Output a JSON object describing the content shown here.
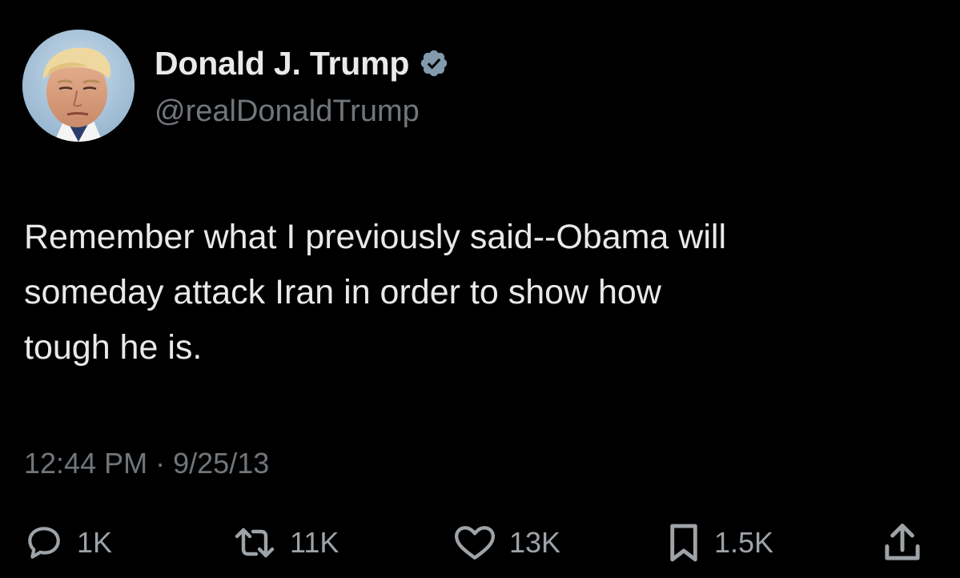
{
  "author": {
    "display_name": "Donald J. Trump",
    "handle": "@realDonaldTrump",
    "verified": true,
    "avatar_icon": "profile-photo"
  },
  "tweet": {
    "text_lines": [
      "Remember what I previously said--Obama will",
      "someday attack Iran in order to show how",
      "tough he is."
    ],
    "time": "12:44 PM",
    "separator": "·",
    "date": "9/25/13"
  },
  "actions": {
    "replies": {
      "icon": "reply-icon",
      "count": "1K"
    },
    "retweets": {
      "icon": "retweet-icon",
      "count": "11K"
    },
    "likes": {
      "icon": "heart-icon",
      "count": "13K"
    },
    "bookmarks": {
      "icon": "bookmark-icon",
      "count": "1.5K"
    },
    "share": {
      "icon": "share-icon"
    }
  },
  "colors": {
    "background": "#000000",
    "primary_text": "#e7e9ea",
    "secondary_text": "#71767b",
    "verified_badge": "#829aab",
    "action_icon": "#9ea3a8"
  }
}
